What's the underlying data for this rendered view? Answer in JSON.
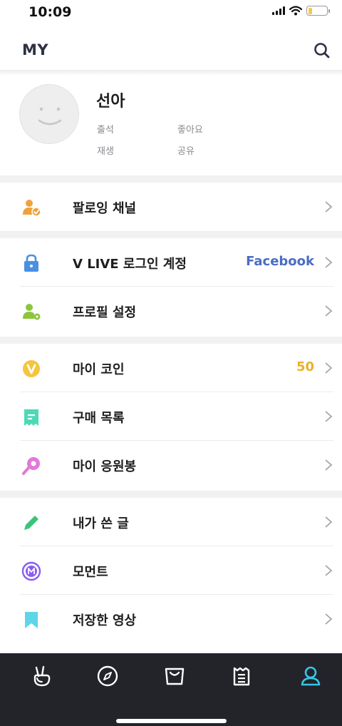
{
  "status_bar": {
    "time": "10:09",
    "battery_level": 0.2,
    "battery_color": "#f2c94c"
  },
  "header": {
    "title": "MY",
    "search_icon": "search-icon"
  },
  "profile": {
    "name": "선아",
    "stats": [
      "출석",
      "좋아요",
      "재생",
      "공유"
    ],
    "avatar_icon": "smiley-face-icon"
  },
  "sections": [
    [
      {
        "label": "팔로잉 채널",
        "icon": "user-check-icon",
        "value": ""
      }
    ],
    [
      {
        "label": "V LIVE 로그인 계정",
        "icon": "lock-icon",
        "value": "Facebook",
        "value_color": "#4a6cc4"
      },
      {
        "label": "프로필 설정",
        "icon": "user-gear-icon",
        "value": ""
      }
    ],
    [
      {
        "label": "마이 코인",
        "icon": "coin-icon",
        "value": "50",
        "value_color": "#e8b12b"
      },
      {
        "label": "구매 목록",
        "icon": "receipt-icon",
        "value": ""
      },
      {
        "label": "마이 응원봉",
        "icon": "lightstick-icon",
        "value": ""
      }
    ],
    [
      {
        "label": "내가 쓴 글",
        "icon": "pencil-icon",
        "value": ""
      },
      {
        "label": "모먼트",
        "icon": "moment-icon",
        "value": ""
      },
      {
        "label": "저장한 영상",
        "icon": "bookmark-icon",
        "value": ""
      }
    ]
  ],
  "tabbar": {
    "tabs": [
      {
        "icon": "v-hand-icon",
        "active": false
      },
      {
        "icon": "compass-icon",
        "active": false
      },
      {
        "icon": "store-icon",
        "active": false
      },
      {
        "icon": "schedule-icon",
        "active": false
      },
      {
        "icon": "profile-icon",
        "active": true
      }
    ],
    "active_color": "#35c7e6",
    "inactive_color": "#ffffff"
  },
  "colors": {
    "follow": "#f0a23a",
    "lock": "#4a90e2",
    "profile_setting": "#8cc63f",
    "coin": "#f5c53d",
    "receipt": "#4fd8b8",
    "lightstick": "#e07ad8",
    "pencil": "#3cc37a",
    "moment": "#8a5cf0",
    "bookmark": "#5fd6e8"
  }
}
